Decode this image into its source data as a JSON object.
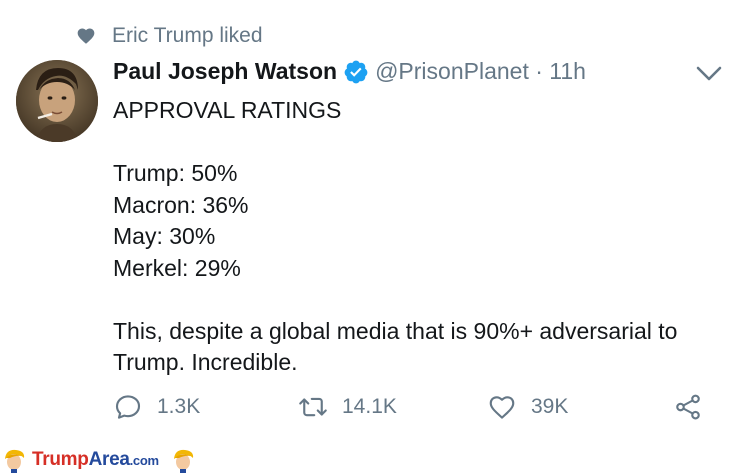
{
  "social_context": {
    "text": "Eric Trump liked"
  },
  "author": {
    "name": "Paul Joseph Watson",
    "handle_time": "@PrisonPlanet · 11h"
  },
  "tweet": {
    "lines": [
      "APPROVAL RATINGS",
      "",
      "Trump: 50%",
      "Macron: 36%",
      "May: 30%",
      "Merkel: 29%",
      "",
      "This, despite a global media that is 90%+ adversarial to",
      "Trump. Incredible."
    ]
  },
  "actions": {
    "replies": "1.3K",
    "retweets": "14.1K",
    "likes": "39K"
  },
  "footer": {
    "brand_red": "Trump",
    "brand_blue": "Area",
    "brand_tld": ".com"
  },
  "colors": {
    "text": "#14171a",
    "muted": "#657786",
    "verified": "#1da1f2",
    "brand_red": "#d62f26",
    "brand_blue": "#244a9c"
  },
  "icons": [
    "heart-icon",
    "verified-badge-icon",
    "chevron-down-icon",
    "reply-icon",
    "retweet-icon",
    "like-icon",
    "share-icon",
    "trump-head-icon"
  ]
}
